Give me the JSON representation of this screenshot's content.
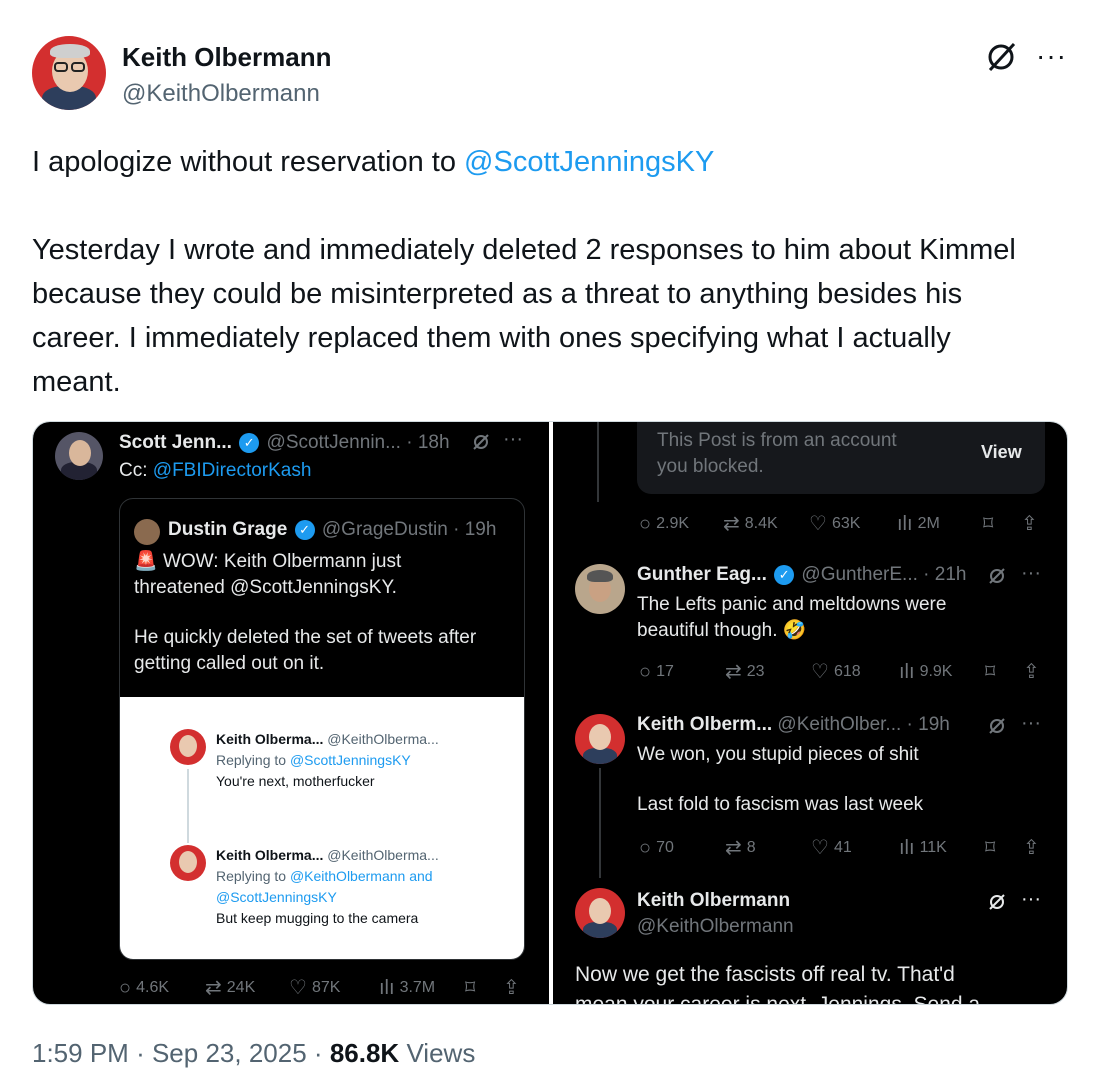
{
  "author": {
    "name": "Keith Olbermann",
    "handle": "@KeithOlbermann"
  },
  "icons": {
    "grok": "grok-icon",
    "more": "more-icon",
    "reply": "reply-icon",
    "repost": "repost-icon",
    "like": "like-icon",
    "views": "views-icon",
    "bookmark": "bookmark-icon",
    "share": "share-icon",
    "verified": "verified-icon"
  },
  "tweet": {
    "line1_prefix": "I apologize without reservation to ",
    "line1_mention": "@ScottJenningsKY",
    "para2": "Yesterday I wrote and immediately deleted 2 responses to him about Kimmel because they could be misinterpreted as a threat to anything besides his career. I immediately replaced them with ones specifying what I actually meant."
  },
  "left_panel": {
    "post": {
      "name": "Scott Jenn...",
      "handle": "@ScottJennin...",
      "time": "· 18h",
      "text_prefix": "Cc: ",
      "mention": "@FBIDirectorKash"
    },
    "quote": {
      "name": "Dustin Grage",
      "handle": "@GrageDustin",
      "time": "· 19h",
      "emoji": "🚨",
      "line1": "WOW: Keith Olbermann just",
      "line2": "threatened @ScottJenningsKY.",
      "line3": "He quickly deleted the set of tweets after",
      "line4": "getting called out on it."
    },
    "screenshot": {
      "reply1": {
        "name": "Keith Olberma...",
        "handle": "@KeithOlberma...",
        "replying_prefix": "Replying to ",
        "replying_to": "@ScottJenningsKY",
        "text": "You're next, motherfucker"
      },
      "reply2": {
        "name": "Keith Olberma...",
        "handle": "@KeithOlberma...",
        "replying_prefix": "Replying to ",
        "replying_to_1": "@KeithOlbermann and",
        "replying_to_2": "@ScottJenningsKY",
        "text": "But keep mugging to the camera"
      }
    },
    "stats": {
      "replies": "4.6K",
      "reposts": "24K",
      "likes": "87K",
      "views": "3.7M"
    }
  },
  "right_panel": {
    "blocked": {
      "line1": "This Post is from an account",
      "line2": "you blocked.",
      "button": "View"
    },
    "stats1": {
      "replies": "2.9K",
      "reposts": "8.4K",
      "likes": "63K",
      "views": "2M"
    },
    "reply_gunther": {
      "name": "Gunther Eag...",
      "handle": "@GuntherE...",
      "time": "· 21h",
      "line1": "The Lefts panic and meltdowns were",
      "line2": "beautiful though. 🤣"
    },
    "stats2": {
      "replies": "17",
      "reposts": "23",
      "likes": "618",
      "views": "9.9K"
    },
    "reply_keith": {
      "name": "Keith Olberm...",
      "handle": "@KeithOlber...",
      "time": "· 19h",
      "line1": "We won, you stupid pieces of shit",
      "line2": "Last fold to fascism was last week"
    },
    "stats3": {
      "replies": "70",
      "reposts": "8",
      "likes": "41",
      "views": "11K"
    },
    "keith_post": {
      "name": "Keith Olbermann",
      "handle": "@KeithOlbermann",
      "line1": "Now we get the fascists off real tv. That'd",
      "line2": "mean your career is next, Jennings. Send a"
    }
  },
  "footer": {
    "time": "1:59 PM",
    "sep1": "·",
    "date": "Sep 23, 2025",
    "sep2": "·",
    "views_count": "86.8K",
    "views_label": "Views"
  }
}
